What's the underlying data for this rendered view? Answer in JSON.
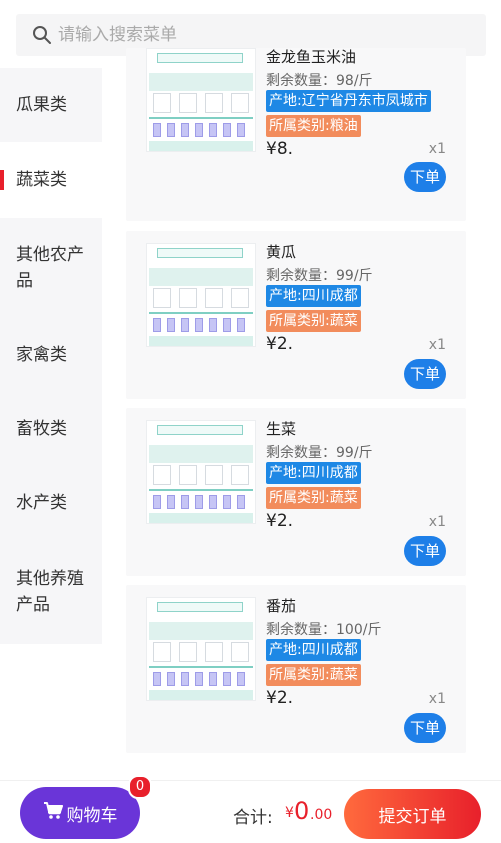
{
  "search": {
    "placeholder": "请输入搜索菜单"
  },
  "sidebar": {
    "items": [
      {
        "label": "瓜果类"
      },
      {
        "label": "蔬菜类"
      },
      {
        "label": "其他农产品"
      },
      {
        "label": "家禽类"
      },
      {
        "label": "畜牧类"
      },
      {
        "label": "水产类"
      },
      {
        "label": "其他养殖产品"
      }
    ],
    "active_index": 1,
    "accent_color": "#e8202b"
  },
  "products": [
    {
      "name": "金龙鱼玉米油",
      "stock": "剩余数量：98/斤",
      "origin": "产地:辽宁省丹东市凤城市",
      "category": "所属类别:粮油",
      "price": "¥8.",
      "qty": "x1",
      "button": "下单"
    },
    {
      "name": "黄瓜",
      "stock": "剩余数量：99/斤",
      "origin": "产地:四川成都",
      "category": "所属类别:蔬菜",
      "price": "¥2.",
      "qty": "x1",
      "button": "下单"
    },
    {
      "name": "生菜",
      "stock": "剩余数量：99/斤",
      "origin": "产地:四川成都",
      "category": "所属类别:蔬菜",
      "price": "¥2.",
      "qty": "x1",
      "button": "下单"
    },
    {
      "name": "番茄",
      "stock": "剩余数量：100/斤",
      "origin": "产地:四川成都",
      "category": "所属类别:蔬菜",
      "price": "¥2.",
      "qty": "x1",
      "button": "下单"
    }
  ],
  "bottom": {
    "cart_label": "购物车",
    "cart_count": "0",
    "total_label": "合计:",
    "total_symbol": "¥",
    "total_int": "0",
    "total_dec": ".00",
    "submit_label": "提交订单"
  },
  "colors": {
    "brand_purple": "#6a35d8",
    "order_blue": "#1e7fe8",
    "origin_tag": "#1e88e5",
    "category_tag": "#f28c5c",
    "price_red": "#e8202b"
  },
  "icons": {
    "search": "search-icon",
    "cart": "cart-icon",
    "thumbnail": "product-image"
  }
}
